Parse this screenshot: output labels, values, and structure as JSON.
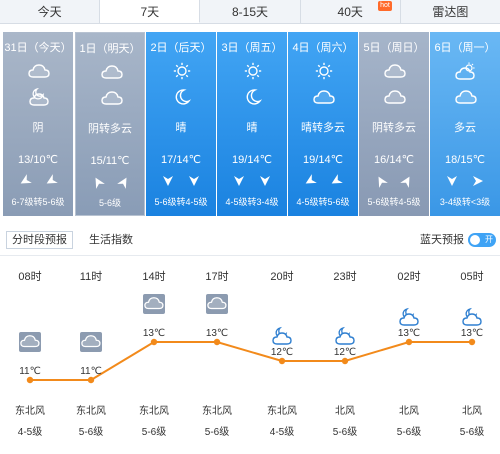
{
  "tabs": [
    {
      "label": "今天"
    },
    {
      "label": "7天",
      "active": true
    },
    {
      "label": "8-15天"
    },
    {
      "label": "40天",
      "badge": "hot"
    },
    {
      "label": "雷达图"
    }
  ],
  "days": [
    {
      "date": "31日（今天）",
      "weather": "阴",
      "temp": "13/10℃",
      "wind": "6-7级转5-6级",
      "icons": [
        "cloud-icon",
        "cloud-moon-icon"
      ],
      "style": "past"
    },
    {
      "date": "1日（明天）",
      "weather": "阴转多云",
      "temp": "15/11℃",
      "wind": "5-6级",
      "icons": [
        "cloud-icon",
        "cloud-icon"
      ],
      "style": "cur"
    },
    {
      "date": "2日（后天）",
      "weather": "晴",
      "temp": "17/14℃",
      "wind": "5-6级转4-5级",
      "icons": [
        "sun-icon",
        "moon-icon"
      ],
      "style": "fut"
    },
    {
      "date": "3日（周五）",
      "weather": "晴",
      "temp": "19/14℃",
      "wind": "4-5级转3-4级",
      "icons": [
        "sun-icon",
        "moon-icon"
      ],
      "style": "fut"
    },
    {
      "date": "4日（周六）",
      "weather": "晴转多云",
      "temp": "19/14℃",
      "wind": "4-5级转5-6级",
      "icons": [
        "sun-icon",
        "cloud-icon"
      ],
      "style": "fut"
    },
    {
      "date": "5日（周日）",
      "weather": "阴转多云",
      "temp": "16/14℃",
      "wind": "5-6级转4-5级",
      "icons": [
        "cloud-icon",
        "cloud-icon"
      ],
      "style": "later"
    },
    {
      "date": "6日（周一）",
      "weather": "多云",
      "temp": "18/15℃",
      "wind": "3-4级转<3级",
      "icons": [
        "sun-cloud-icon",
        "cloud-icon"
      ],
      "style": "last"
    }
  ],
  "subtabs": {
    "hourly": "分时段预报",
    "life": "生活指数",
    "blue_sky": "蓝天预报",
    "toggle": "开"
  },
  "colors": {
    "line": "#f28a1b",
    "icon_box": "#8c9bb0",
    "blue_icon": "#2f7fd0"
  },
  "chart_data": {
    "type": "line",
    "categories": [
      "08时",
      "11时",
      "14时",
      "17时",
      "20时",
      "23时",
      "02时",
      "05时"
    ],
    "values": [
      11,
      11,
      13,
      13,
      12,
      12,
      13,
      13
    ],
    "value_labels": [
      "11℃",
      "11℃",
      "13℃",
      "13℃",
      "12℃",
      "12℃",
      "13℃",
      "13℃"
    ],
    "icons": [
      "cloud-icon",
      "cloud-icon",
      "cloud-icon",
      "cloud-icon",
      "cloud-moon-icon",
      "cloud-moon-icon",
      "cloud-moon-icon",
      "cloud-moon-icon"
    ],
    "wind_dir": [
      "东北风",
      "东北风",
      "东北风",
      "东北风",
      "东北风",
      "北风",
      "北风",
      "北风"
    ],
    "wind_level": [
      "4-5级",
      "5-6级",
      "5-6级",
      "5-6级",
      "4-5级",
      "5-6级",
      "5-6级",
      "5-6级"
    ]
  }
}
